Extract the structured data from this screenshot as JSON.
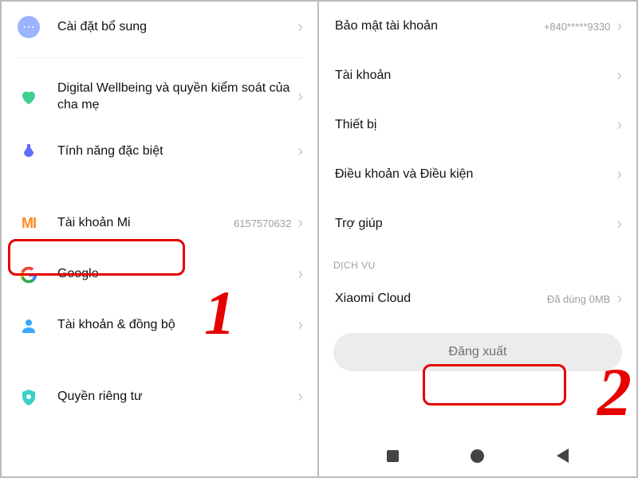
{
  "left": {
    "additional_settings": "Cài đặt bổ sung",
    "digital_wellbeing": "Digital Wellbeing và quyền kiểm soát của cha mẹ",
    "special_features": "Tính năng đặc biệt",
    "mi_account": "Tài khoản Mi",
    "mi_account_id": "6157570632",
    "google": "Google",
    "accounts_sync": "Tài khoản & đồng bộ",
    "privacy": "Quyền riêng tư"
  },
  "right": {
    "account_security": "Bảo mật tài khoản",
    "phone_masked": "+840*****9330",
    "accounts": "Tài khoản",
    "devices": "Thiết bị",
    "terms": "Điều khoản và Điều kiện",
    "help": "Trợ giúp",
    "section_services": "DỊCH VỤ",
    "xiaomi_cloud": "Xiaomi Cloud",
    "cloud_used": "Đã dùng 0MB",
    "sign_out": "Đăng xuất"
  },
  "annotations": {
    "one": "1",
    "two": "2"
  }
}
